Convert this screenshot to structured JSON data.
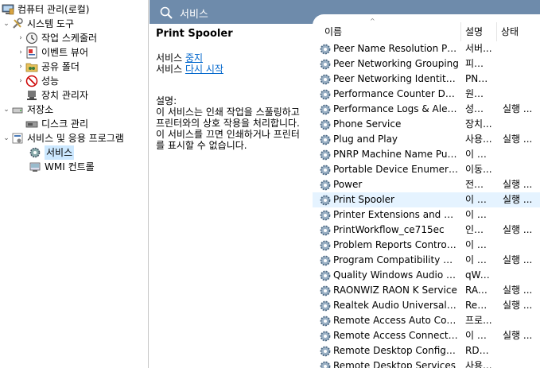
{
  "tree": {
    "root": "컴퓨터 관리(로컬)",
    "system_tools": "시스템 도구",
    "task_scheduler": "작업 스케줄러",
    "event_viewer": "이벤트 뷰어",
    "shared_folders": "공유 폴더",
    "performance": "성능",
    "device_manager": "장치 관리자",
    "storage": "저장소",
    "disk_management": "디스크 관리",
    "services_apps": "서비스 및 응용 프로그램",
    "services": "서비스",
    "wmi": "WMI 컨트롤"
  },
  "header": {
    "title": "서비스"
  },
  "detail": {
    "name": "Print Spooler",
    "stop_prefix": "서비스 ",
    "stop_link": "중지",
    "restart_prefix": "서비스 ",
    "restart_link": "다시 시작",
    "desc_label": "설명:",
    "desc_lines": [
      "이 서비스는 인쇄 작업을 스풀링하고",
      "프린터와의 상호 작용을 처리합니다.",
      "이 서비스를 끄면 인쇄하거나 프린터",
      "를 표시할 수 없습니다."
    ]
  },
  "columns": {
    "name": "이름",
    "desc": "설명",
    "status": "상태"
  },
  "rows": [
    {
      "name": "Peer Name Resolution Prot...",
      "desc": "서버...",
      "status": ""
    },
    {
      "name": "Peer Networking Grouping",
      "desc": "피어 ...",
      "status": ""
    },
    {
      "name": "Peer Networking Identity ...",
      "desc": "PNR...",
      "status": ""
    },
    {
      "name": "Performance Counter DLL ...",
      "desc": "원경 ...",
      "status": ""
    },
    {
      "name": "Performance Logs & Alerts",
      "desc": "성능 ...",
      "status": "실행 ..."
    },
    {
      "name": "Phone Service",
      "desc": "장치...",
      "status": ""
    },
    {
      "name": "Plug and Play",
      "desc": "사용...",
      "status": "실행 ..."
    },
    {
      "name": "PNRP Machine Name Publi...",
      "desc": "이 서...",
      "status": ""
    },
    {
      "name": "Portable Device Enumerato...",
      "desc": "이동...",
      "status": ""
    },
    {
      "name": "Power",
      "desc": "전원 ...",
      "status": "실행 ..."
    },
    {
      "name": "Print Spooler",
      "desc": "이 서...",
      "status": "실행 ..."
    },
    {
      "name": "Printer Extensions and Noti...",
      "desc": "이 서...",
      "status": ""
    },
    {
      "name": "PrintWorkflow_ce715ec",
      "desc": "인쇄 ...",
      "status": "실행 ..."
    },
    {
      "name": "Problem Reports Control P...",
      "desc": "이 서...",
      "status": ""
    },
    {
      "name": "Program Compatibility Assi...",
      "desc": "이 서...",
      "status": "실행 ..."
    },
    {
      "name": "Quality Windows Audio Vi...",
      "desc": "qWa...",
      "status": ""
    },
    {
      "name": "RAONWIZ RAON K Service",
      "desc": "RAO...",
      "status": "실행 ..."
    },
    {
      "name": "Realtek Audio Universal Ser...",
      "desc": "Realt...",
      "status": "실행 ..."
    },
    {
      "name": "Remote Access Auto Conn...",
      "desc": "프로...",
      "status": ""
    },
    {
      "name": "Remote Access Connection...",
      "desc": "이 컴...",
      "status": "실행 ..."
    },
    {
      "name": "Remote Desktop Configura...",
      "desc": "RDC...",
      "status": ""
    },
    {
      "name": "Remote Desktop Services",
      "desc": "사용...",
      "status": ""
    }
  ],
  "selected_row": 10,
  "colors": {
    "header_bg": "#6e8bab",
    "selection": "#cce8ff",
    "link": "#0066cc"
  }
}
